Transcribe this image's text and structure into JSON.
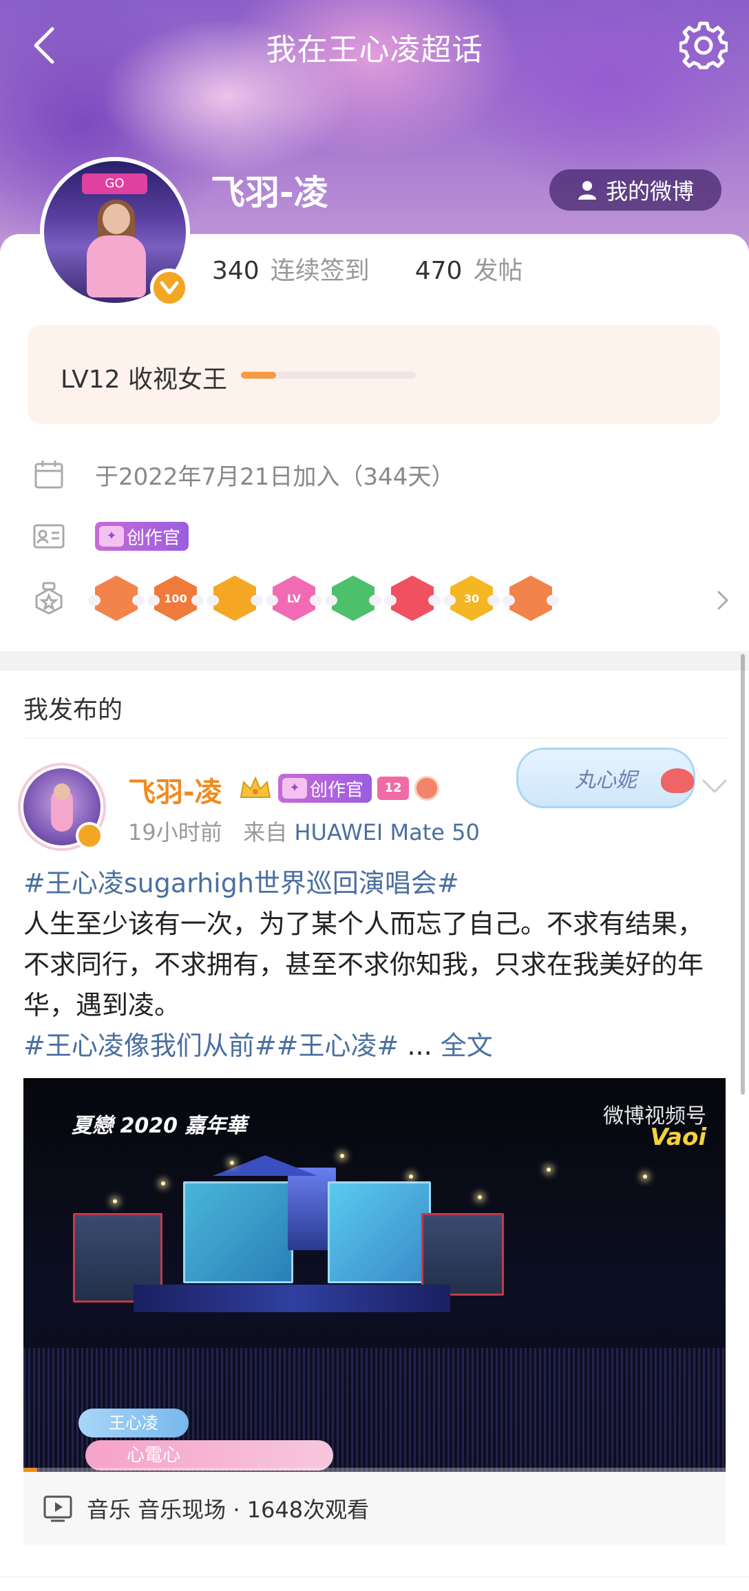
{
  "header": {
    "title": "我在王心凌超话"
  },
  "profile": {
    "nickname": "飞羽-凌",
    "my_weibo_label": "我的微博",
    "avatar_sign_text": "GO",
    "stats": [
      {
        "value": "340",
        "label": "连续签到"
      },
      {
        "value": "470",
        "label": "发帖"
      }
    ],
    "level": {
      "text": "LV12 收视女王",
      "progress": 0.2
    },
    "join_text": "于2022年7月21日加入（344天）",
    "creator_tag": "创作官",
    "badges": [
      {
        "name": "rabbit-badge",
        "color": "#f2834a",
        "text": ""
      },
      {
        "name": "100-days-badge",
        "color": "#f07a3a",
        "text": "100"
      },
      {
        "name": "crown-badge",
        "color": "#f5a623",
        "text": ""
      },
      {
        "name": "lv-badge",
        "color": "#f06bb4",
        "text": "LV"
      },
      {
        "name": "hand-badge",
        "color": "#4cc06a",
        "text": ""
      },
      {
        "name": "trophy-badge",
        "color": "#f05060",
        "text": ""
      },
      {
        "name": "30-days-badge",
        "color": "#f5b623",
        "text": "30"
      },
      {
        "name": "rock-hand-badge",
        "color": "#f2834a",
        "text": ""
      }
    ]
  },
  "section": {
    "title": "我发布的"
  },
  "post": {
    "author": "飞羽-凌",
    "creator_tag": "创作官",
    "level_tag": "12",
    "sticker_text": "丸心妮",
    "time": "19小时前",
    "source_prefix": "来自",
    "device": "HUAWEI Mate 50",
    "topic": "#王心凌sugarhigh世界巡回演唱会#",
    "text": "人生至少该有一次，为了某个人而忘了自己。不求有结果，不求同行，不求拥有，甚至不求你知我，只求在我美好的年华，遇到凌。",
    "tags": "#王心凌像我们从前##王心凌#",
    "ellipsis": " ... ",
    "full_text": "全文",
    "video": {
      "logo_left": "夏戀 2020 嘉年華",
      "logo_right_top": "微博视频号",
      "logo_right_bottom": "Vaoi",
      "caption_name": "王心凌",
      "caption_song": "心電心",
      "progress": 0.02,
      "footer": "音乐 音乐现场 · 1648次观看"
    }
  },
  "colors": {
    "accent_orange": "#f08a1e",
    "link_blue": "#4a6fa0",
    "verify_gold": "#f2a623"
  }
}
